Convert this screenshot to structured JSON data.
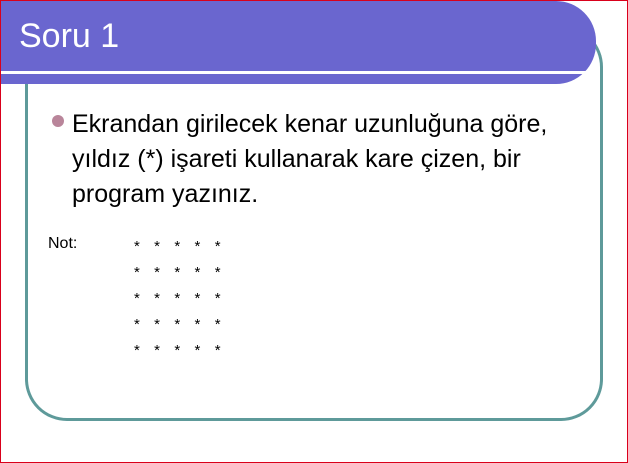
{
  "slide": {
    "title": "Soru 1",
    "bullet_text": "Ekrandan girilecek kenar uzunluğuna göre, yıldız (*) işareti kullanarak kare çizen, bir program yazınız.",
    "note_label": "Not:",
    "pattern_rows": [
      "*  *  *  *  *",
      "*  *  *  *  *",
      "*  *  *  *  *",
      "*  *  *  *  *",
      "*  *  *  *  *"
    ]
  },
  "colors": {
    "title_bar": "#6a66cf",
    "frame_border": "#5e9a9a",
    "bullet": "#b9859a",
    "outer_border": "#d9001b"
  }
}
